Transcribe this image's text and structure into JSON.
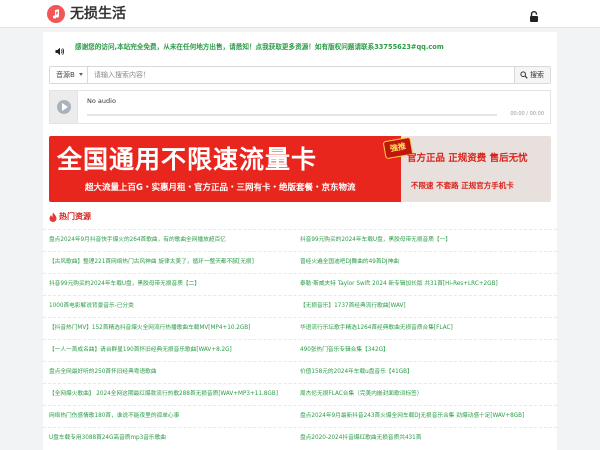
{
  "header": {
    "brand": "无损生活",
    "logo_icon": "music-note-icon",
    "lock_icon": "unlock-icon"
  },
  "notice": {
    "icon": "speaker-icon",
    "text": "感谢您的访问,本站完全免费，从未在任何地方出售，请悉知！点我获取更多资源！如有版权问题请联系33755623#qq.com"
  },
  "search": {
    "source_label": "音源B",
    "placeholder": "请输入搜索内容！",
    "button_label": "搜索"
  },
  "player": {
    "title": "No audio",
    "time": "00:00 / 00:00"
  },
  "banner": {
    "title": "全国通用不限速流量卡",
    "badge": "強推",
    "subtitle": "超大流量上百G・实惠月租・官方正品・三网有卡・绝版套餐・京东物流",
    "right_top": "官方正品 正规资费 售后无忧",
    "right_bottom": "不限速 不套路 正规官方手机卡"
  },
  "section": {
    "title": "热门资源",
    "icon": "flame-icon"
  },
  "resources": [
    [
      "盘点2024年9月抖音快手爆火的264首歌曲，有的歌曲全网播放超百亿",
      "抖音99元购买的2024年车载U盘，黑胶母带无损音质【一】"
    ],
    [
      "【古风歌曲】整理221首网络热门古风神曲 旋律太美了，循环一整天都不腻[无损]",
      "曾经火遍全国迪吧DJ舞曲的49首DJ神曲"
    ],
    [
      "抖音99元购买的2024年车载U盘，黑胶母带无损音质【二】",
      "泰勒·斯威夫特 Taylor Swift 2024 新专辑加长版 共31首[Hi-Res+LRC+2GB]"
    ],
    [
      "1000首电影解说背景音乐-已分类",
      "【无损音乐】1737首经典流行歌曲[WAV]"
    ],
    [
      "【抖音热门MV】152首精选抖音爆火全网流行热播歌曲车载MV[MP4+10.2GB]",
      "华语流行乐坛歌手精选1264首经典歌曲无损音质合集[FLAC]"
    ],
    [
      "【一人一首成名曲】请台群星190首怀旧经典无损音乐歌曲[WAV+8.2G]",
      "490张热门音乐专辑合集【342G】"
    ],
    [
      "盘点全网最好听的250首怀旧经典粤语歌曲",
      "价值158元的2024年车载u盘音乐【41GB】"
    ],
    [
      "【全网爆火歌曲】 2024全网这期最红爆款流行热歌288首无损音质[WAV+MP3+11.8GB]",
      "周杰伦无损FLAC合集（完美内嵌封面歌词标签）"
    ],
    [
      "网络热门伤感情歌180首，谁说不能夜里的孤单心事",
      "盘点2024年9月最新抖音243首火爆全网车载DJ无损音乐合集 劲爆动感十足[WAV+8GB]"
    ],
    [
      "U盘车载专用3088首24G高音质mp3音乐歌曲",
      "盘点2020-2024抖音爆红歌曲无损音质共431首"
    ]
  ]
}
